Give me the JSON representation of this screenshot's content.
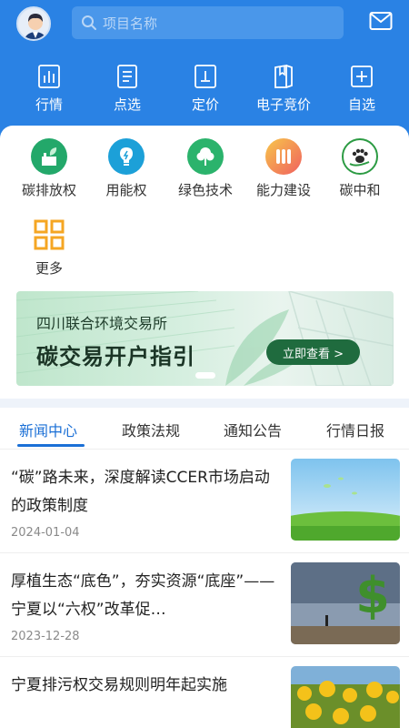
{
  "header": {
    "search_placeholder": "项目名称"
  },
  "top_nav": [
    {
      "label": "行情",
      "icon": "market-chart-icon"
    },
    {
      "label": "点选",
      "icon": "list-document-icon"
    },
    {
      "label": "定价",
      "icon": "price-tag-icon"
    },
    {
      "label": "电子竞价",
      "icon": "bidding-book-icon"
    },
    {
      "label": "自选",
      "icon": "add-favorite-icon"
    }
  ],
  "quick_menu": [
    {
      "label": "碳排放权",
      "icon": "factory-leaf-icon",
      "color": "#23a86a"
    },
    {
      "label": "用能权",
      "icon": "lightbulb-icon",
      "color": "#1ca0d8"
    },
    {
      "label": "绿色技术",
      "icon": "tree-icon",
      "color": "#2bb36c"
    },
    {
      "label": "能力建设",
      "icon": "capacity-bars-icon",
      "color": "#f07a5a"
    },
    {
      "label": "碳中和",
      "icon": "paw-leaf-icon",
      "color": "#2c9b43"
    },
    {
      "label": "更多",
      "icon": "grid-more-icon",
      "color": "#f5a623"
    }
  ],
  "banner": {
    "subtitle": "四川联合环境交易所",
    "title": "碳交易开户指引",
    "button": "立即查看 >"
  },
  "tabs": [
    "新闻中心",
    "政策法规",
    "通知公告",
    "行情日报"
  ],
  "news": [
    {
      "title": "“碳”路未来，深度解读CCER市场启动的政策制度",
      "date": "2024-01-04"
    },
    {
      "title": "厚植生态“底色”，夯实资源“底座”——宁夏以“六权”改革促…",
      "date": "2023-12-28"
    },
    {
      "title": "宁夏排污权交易规则明年起实施",
      "date": ""
    }
  ]
}
